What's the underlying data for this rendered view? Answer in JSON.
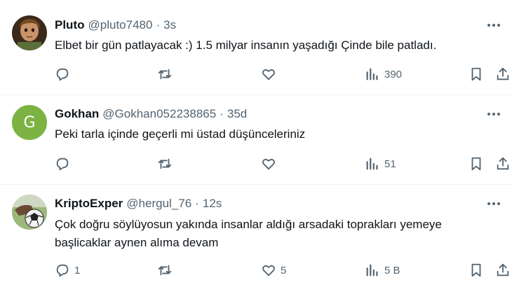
{
  "tweets": [
    {
      "name": "Pluto",
      "handle": "@pluto7480",
      "dot": "·",
      "time": "3s",
      "text_lines": [
        "Elbet bir gün patlayacak :) 1.5 milyar insanın yaşadığı Çinde bile patladı."
      ],
      "replies": "",
      "retweets": "",
      "likes": "",
      "views": "390",
      "avatar": "painting-portrait"
    },
    {
      "name": "Gokhan",
      "handle": "@Gokhan052238865",
      "dot": "·",
      "time": "35d",
      "text_lines": [
        "Peki tarla içinde geçerli mi üstad düşünceleriniz"
      ],
      "replies": "",
      "retweets": "",
      "likes": "",
      "views": "51",
      "avatar_letter": "G",
      "avatar_color": "#7cb342"
    },
    {
      "name": "KriptoExper",
      "handle": "@hergul_76",
      "dot": "·",
      "time": "12s",
      "text_lines": [
        "Çok doğru söylüyosun yakında insanlar aldığı arsadaki toprakları yemeye",
        "başlicaklar aynen alıma devam"
      ],
      "replies": "1",
      "retweets": "",
      "likes": "5",
      "views": "5 B",
      "avatar": "football-photo"
    }
  ],
  "icons": {
    "reply": "reply-icon",
    "retweet": "retweet-icon",
    "like": "like-icon",
    "views": "views-icon",
    "bookmark": "bookmark-icon",
    "share": "share-icon",
    "more": "more-icon"
  },
  "colors": {
    "text": "#0f1419",
    "muted": "#536471",
    "divider": "#eff3f4"
  }
}
